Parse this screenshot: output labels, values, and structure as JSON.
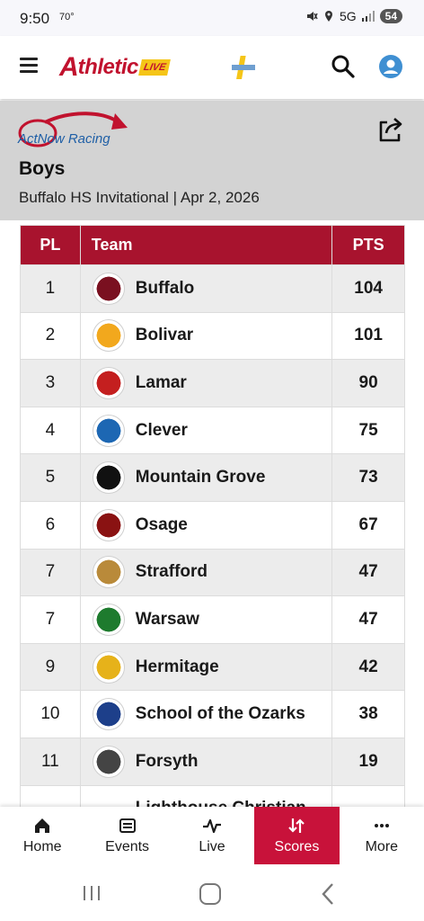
{
  "status_bar": {
    "time": "9:50",
    "temp": "70°",
    "network": "5G",
    "battery": "54"
  },
  "app": {
    "logo_text": "thletic",
    "logo_initial": "A",
    "logo_badge": "LIVE"
  },
  "meet": {
    "sponsor": "ActNow Racing",
    "gender": "Boys",
    "subtitle": "Buffalo HS Invitational | Apr 2, 2026"
  },
  "table": {
    "headers": {
      "place": "PL",
      "team": "Team",
      "points": "PTS"
    },
    "rows": [
      {
        "place": "1",
        "team": "Buffalo",
        "points": "104",
        "logo_color": "#7a1020"
      },
      {
        "place": "2",
        "team": "Bolivar",
        "points": "101",
        "logo_color": "#f2a81d"
      },
      {
        "place": "3",
        "team": "Lamar",
        "points": "90",
        "logo_color": "#c41f1f"
      },
      {
        "place": "4",
        "team": "Clever",
        "points": "75",
        "logo_color": "#1d67b3"
      },
      {
        "place": "5",
        "team": "Mountain Grove",
        "points": "73",
        "logo_color": "#111111"
      },
      {
        "place": "6",
        "team": "Osage",
        "points": "67",
        "logo_color": "#8a1212"
      },
      {
        "place": "7",
        "team": "Strafford",
        "points": "47",
        "logo_color": "#b98a3a"
      },
      {
        "place": "7",
        "team": "Warsaw",
        "points": "47",
        "logo_color": "#1e7b2e"
      },
      {
        "place": "9",
        "team": "Hermitage",
        "points": "42",
        "logo_color": "#e6b21a"
      },
      {
        "place": "10",
        "team": "School of the Ozarks",
        "points": "38",
        "logo_color": "#1d3f8a"
      },
      {
        "place": "11",
        "team": "Forsyth",
        "points": "19",
        "logo_color": "#444444"
      },
      {
        "place": "",
        "team": "Lighthouse Christian",
        "points": "",
        "logo_color": "#ffffff"
      }
    ]
  },
  "bottom_nav": [
    {
      "label": "Home",
      "icon": "home-icon"
    },
    {
      "label": "Events",
      "icon": "list-icon"
    },
    {
      "label": "Live",
      "icon": "pulse-icon"
    },
    {
      "label": "Scores",
      "icon": "sort-icon",
      "active": true
    },
    {
      "label": "More",
      "icon": "more-icon"
    }
  ],
  "colors": {
    "brand": "#c1122e",
    "table_header": "#a8132e",
    "active_tab": "#c8123a",
    "banner": "#d3d3d3"
  }
}
